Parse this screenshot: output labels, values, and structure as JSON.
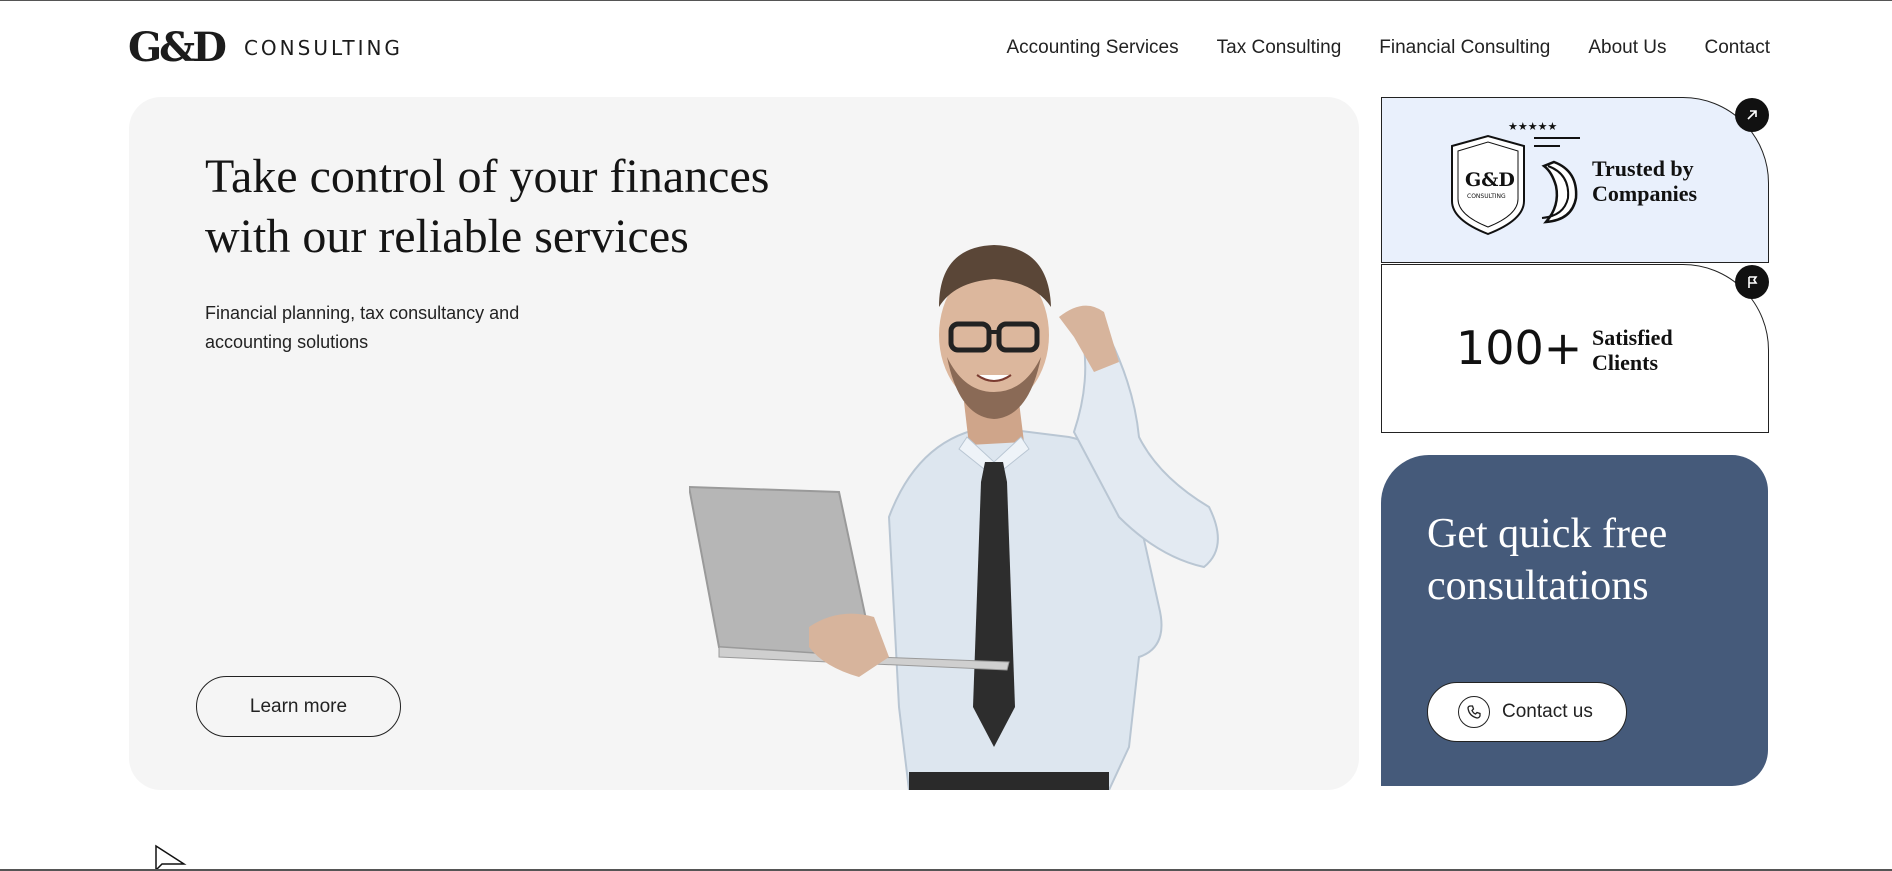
{
  "header": {
    "logo_mark": "G&D",
    "logo_text": "CONSULTING",
    "nav": [
      "Accounting Services",
      "Tax Consulting",
      "Financial Consulting",
      "About Us",
      "Contact"
    ]
  },
  "hero": {
    "title": "Take control of your finances with our reliable services",
    "subtitle": "Financial planning, tax consultancy and accounting solutions",
    "cta": "Learn more"
  },
  "cards": {
    "trusted": {
      "stars": "★★★★★",
      "badge_mark": "G&D",
      "badge_text": "CONSULTING",
      "label_line1": "Trusted by",
      "label_line2": "Companies"
    },
    "clients": {
      "number": "100+",
      "label_line1": "Satisfied",
      "label_line2": "Clients"
    },
    "consult": {
      "title": "Get quick free consultations",
      "button": "Contact us"
    }
  },
  "icons": {
    "corner1": "arrow-up-right-icon",
    "corner2": "flag-icon",
    "contact": "phone-icon"
  },
  "colors": {
    "card_blue": "#e9f0fc",
    "consult_bg": "#455a7a",
    "hero_bg": "#f5f5f5"
  }
}
